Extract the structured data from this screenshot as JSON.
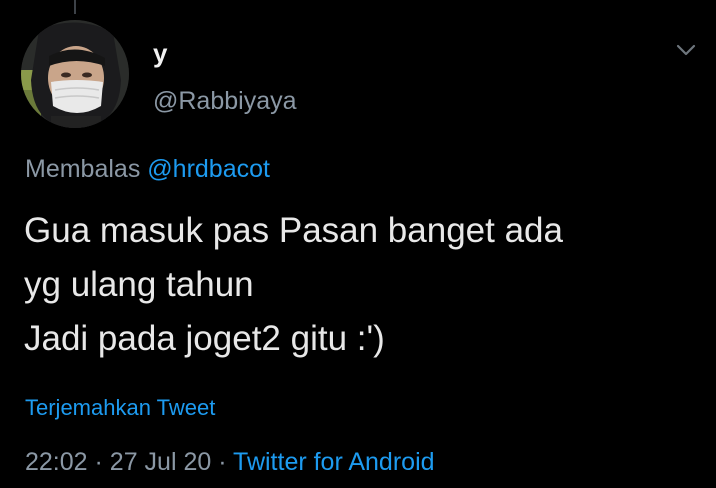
{
  "tweet": {
    "display_name": "y",
    "handle": "@Rabbiyaya",
    "reply_prefix": "Membalas",
    "reply_mention": "@hrdbacot",
    "text_lines": [
      "Gua masuk pas Pasan banget ada",
      "yg ulang tahun",
      "Jadi pada joget2 gitu :')"
    ],
    "translate_label": "Terjemahkan Tweet",
    "time": "22:02",
    "separator": "·",
    "date": "27 Jul 20",
    "source": "Twitter for Android"
  },
  "icons": {
    "avatar": "avatar-photo-masked-person",
    "menu": "chevron-down-icon"
  },
  "colors": {
    "background": "#000000",
    "text": "#e8e8e8",
    "secondary": "#8b98a5",
    "accent": "#1d9bf0"
  }
}
